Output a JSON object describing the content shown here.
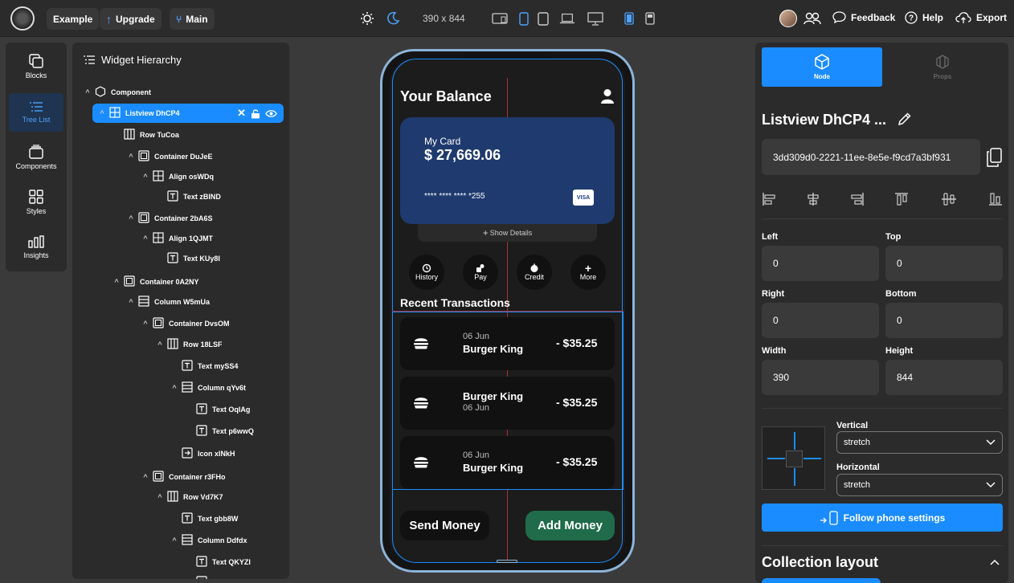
{
  "topbar": {
    "project_name": "Example",
    "upgrade_label": "Upgrade",
    "branch_label": "Main",
    "device_size": "390 x 844",
    "feedback_label": "Feedback",
    "help_label": "Help",
    "export_label": "Export"
  },
  "left_rail": {
    "items": [
      {
        "label": "Blocks",
        "icon": "blocks-icon"
      },
      {
        "label": "Tree List",
        "icon": "tree-list-icon"
      },
      {
        "label": "Components",
        "icon": "components-icon"
      },
      {
        "label": "Styles",
        "icon": "styles-icon"
      },
      {
        "label": "Insights",
        "icon": "insights-icon"
      }
    ]
  },
  "tree": {
    "title": "Widget Hierarchy",
    "nodes": [
      {
        "label": "Component",
        "depth": 0,
        "icon": "component",
        "caret": "^"
      },
      {
        "label": "Listview DhCP4",
        "depth": 1,
        "icon": "grid",
        "caret": "^",
        "selected": true
      },
      {
        "label": "Row TuCoa",
        "depth": 2,
        "icon": "row",
        "caret": ""
      },
      {
        "label": "Container DuJeE",
        "depth": 3,
        "icon": "container",
        "caret": "^"
      },
      {
        "label": "Align osWDq",
        "depth": 4,
        "icon": "align",
        "caret": "^"
      },
      {
        "label": "Text zBIND",
        "depth": 5,
        "icon": "text",
        "caret": ""
      },
      {
        "label": "Container 2bA6S",
        "depth": 3,
        "icon": "container",
        "caret": "^"
      },
      {
        "label": "Align 1QJMT",
        "depth": 4,
        "icon": "align",
        "caret": "^"
      },
      {
        "label": "Text KUy8I",
        "depth": 5,
        "icon": "text",
        "caret": ""
      },
      {
        "label": "Container 0A2NY",
        "depth": 2,
        "icon": "container",
        "caret": "^"
      },
      {
        "label": "Column W5mUa",
        "depth": 3,
        "icon": "column",
        "caret": "^"
      },
      {
        "label": "Container DvsOM",
        "depth": 4,
        "icon": "container",
        "caret": "^"
      },
      {
        "label": "Row 18LSF",
        "depth": 5,
        "icon": "row",
        "caret": "^"
      },
      {
        "label": "Text mySS4",
        "depth": 6,
        "icon": "text",
        "caret": ""
      },
      {
        "label": "Column qYv6t",
        "depth": 6,
        "icon": "column",
        "caret": "^"
      },
      {
        "label": "Text OqIAg",
        "depth": 7,
        "icon": "text",
        "caret": ""
      },
      {
        "label": "Text p6wwQ",
        "depth": 7,
        "icon": "text",
        "caret": ""
      },
      {
        "label": "Icon xlNkH",
        "depth": 6,
        "icon": "icon",
        "caret": ""
      },
      {
        "label": "Container r3FHo",
        "depth": 4,
        "icon": "container",
        "caret": "^"
      },
      {
        "label": "Row Vd7K7",
        "depth": 5,
        "icon": "row",
        "caret": "^"
      },
      {
        "label": "Text gbb8W",
        "depth": 6,
        "icon": "text",
        "caret": ""
      },
      {
        "label": "Column Ddfdx",
        "depth": 6,
        "icon": "column",
        "caret": "^"
      },
      {
        "label": "Text QKYZI",
        "depth": 7,
        "icon": "text",
        "caret": ""
      },
      {
        "label": "Text ...",
        "depth": 7,
        "icon": "text",
        "caret": ""
      }
    ]
  },
  "phone": {
    "header": "Your Balance",
    "card_title": "My Card",
    "card_balance": "$ 27,669.06",
    "card_number": "**** **** **** *255",
    "card_brand": "VISA",
    "show_details": "Show Details",
    "actions": [
      "History",
      "Pay",
      "Credit",
      "More"
    ],
    "section_title": "Recent Transactions",
    "transactions": [
      {
        "date": "06 Jun",
        "merchant": "Burger King",
        "amount": "- $35.25",
        "date_first": true
      },
      {
        "date": "06 Jun",
        "merchant": "Burger King",
        "amount": "- $35.25",
        "date_first": false
      },
      {
        "date": "06 Jun",
        "merchant": "Burger King",
        "amount": "- $35.25",
        "date_first": true
      }
    ],
    "send_money": "Send Money",
    "add_money": "Add Money"
  },
  "rpanel": {
    "tab_node": "Node",
    "tab_props": "Props",
    "widget_name": "Listview DhCP4 ...",
    "widget_id": "3dd309d0-2221-11ee-8e5e-f9cd7a3bf931",
    "left_label": "Left",
    "left_value": "0",
    "top_label": "Top",
    "top_value": "0",
    "right_label": "Right",
    "right_value": "0",
    "bottom_label": "Bottom",
    "bottom_value": "0",
    "width_label": "Width",
    "width_value": "390",
    "height_label": "Height",
    "height_value": "844",
    "vertical_label": "Vertical",
    "vertical_value": "stretch",
    "horizontal_label": "Horizontal",
    "horizontal_value": "stretch",
    "follow_label": "Follow phone settings",
    "collection_label": "Collection layout"
  },
  "colors": {
    "accent": "#1a8cff",
    "card": "#1e3a6e",
    "add_money": "#1f6b4a"
  }
}
